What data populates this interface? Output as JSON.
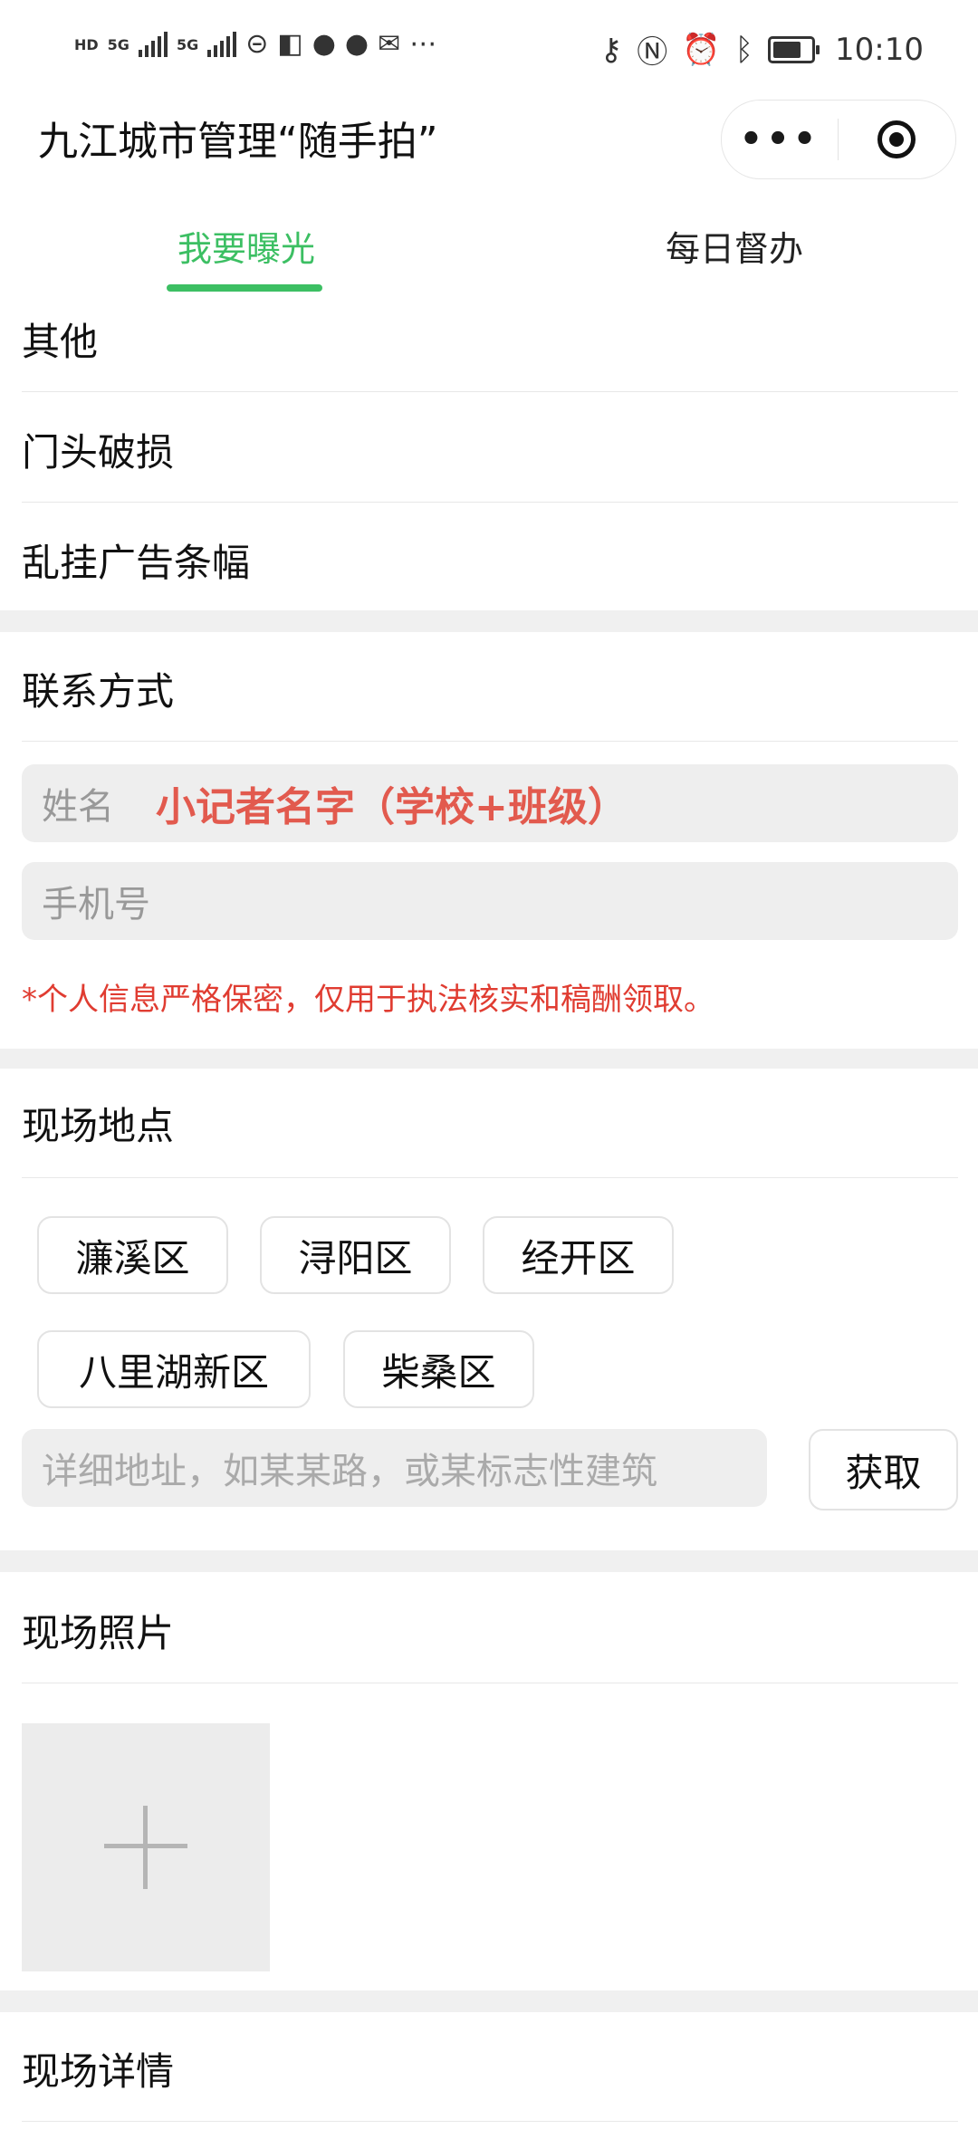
{
  "status_bar": {
    "left_labels": [
      "HD",
      "5G",
      "5G"
    ],
    "time": "10:10",
    "icons": [
      "hd-icon",
      "signal-icon",
      "signal-icon",
      "wifi-icon",
      "app-icon",
      "chat-icon",
      "chat-icon",
      "mail-icon",
      "more-dots-icon",
      "key-icon",
      "nfc-icon",
      "alarm-icon",
      "bluetooth-icon",
      "battery-icon"
    ]
  },
  "app": {
    "title": "九江城市管理“随手拍”",
    "more_label": "•••"
  },
  "tabs": [
    {
      "label": "我要曝光",
      "active": true
    },
    {
      "label": "每日督办",
      "active": false
    }
  ],
  "category_list": [
    "其他",
    "门头破损",
    "乱挂广告条幅"
  ],
  "contact": {
    "title": "联系方式",
    "name_placeholder": "姓名",
    "name_overlay": "小记者名字（学校+班级）",
    "phone_placeholder": "手机号",
    "notice": "*个人信息严格保密，仅用于执法核实和稿酬领取。"
  },
  "location": {
    "title": "现场地点",
    "districts": [
      "濂溪区",
      "浔阳区",
      "经开区",
      "八里湖新区",
      "柴桑区"
    ],
    "address_placeholder": "详细地址，如某某路，或某标志性建筑",
    "get_button": "获取"
  },
  "photos": {
    "title": "现场照片"
  },
  "details": {
    "title": "现场详情"
  },
  "colors": {
    "accent": "#3cbf63",
    "notice_red": "#e03c31",
    "overlay_red": "#e25a4e",
    "section_gap": "#f0f0f0",
    "field_bg": "#eeeeee"
  }
}
